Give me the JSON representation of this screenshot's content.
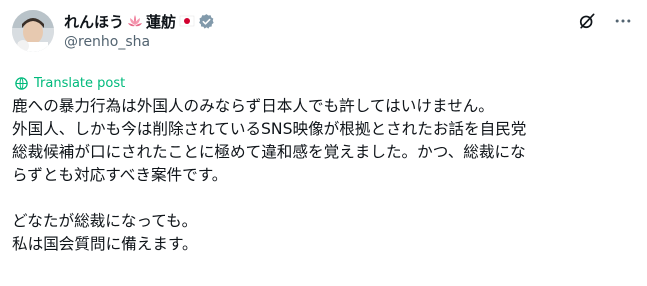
{
  "header": {
    "display_name": "れんほう",
    "display_name_suffix": "蓮舫",
    "handle": "@renho_sha",
    "icons": [
      "lotus-emoji-icon",
      "japan-flag-icon",
      "verified-badge-icon",
      "grok-icon",
      "more-icon"
    ]
  },
  "translate": {
    "label": "Translate post",
    "icon": "globe-icon"
  },
  "post": {
    "line1": "鹿への暴力行為は外国人のみならず日本人でも許してはいけません。",
    "paragraph2": "外国人、しかも今は削除されているSNS映像が根拠とされたお話を自民党\n総裁候補が口にされたことに極めて違和感を覚えました。かつ、総裁にな\nらずとも対応すべき案件です。",
    "line3": "どなたが総裁になっても。",
    "line4": "私は国会質問に備えます。"
  },
  "colors": {
    "text": "#0f1419",
    "secondary": "#536471",
    "translate": "#00ba7c",
    "verified": "#829aab"
  }
}
